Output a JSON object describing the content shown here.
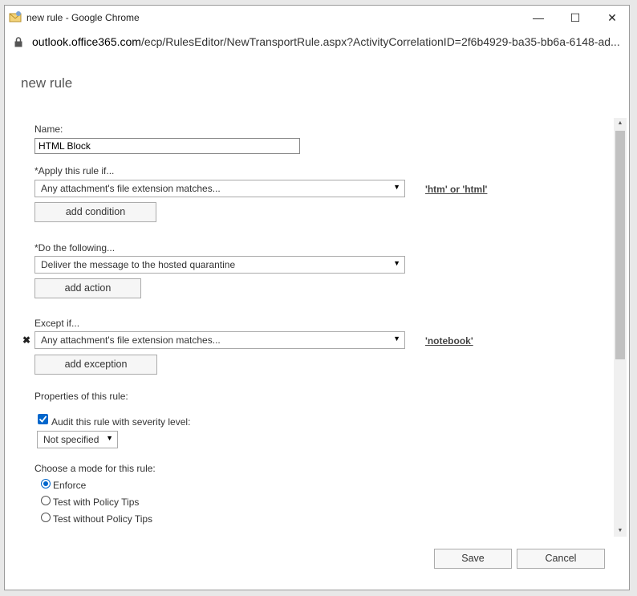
{
  "window": {
    "title": "new rule - Google Chrome",
    "controls": {
      "minimize": "—",
      "maximize": "☐",
      "close": "✕"
    }
  },
  "address_bar": {
    "domain": "outlook.office365.com",
    "path": "/ecp/RulesEditor/NewTransportRule.aspx?ActivityCorrelationID=2f6b4929-ba35-bb6a-6148-ad..."
  },
  "page": {
    "title": "new rule"
  },
  "form": {
    "name_label": "Name:",
    "name_value": "HTML Block",
    "apply_label": "*Apply this rule if...",
    "apply_select": "Any attachment's file extension matches...",
    "apply_link": "'htm' or 'html'",
    "add_condition": "add condition",
    "do_label": "*Do the following...",
    "do_select": "Deliver the message to the hosted quarantine",
    "add_action": "add action",
    "except_label": "Except if...",
    "except_remove": "✖",
    "except_select": "Any attachment's file extension matches...",
    "except_link": "'notebook'",
    "add_exception": "add exception",
    "properties_label": "Properties of this rule:",
    "audit_checked": true,
    "audit_label": "Audit this rule with severity level:",
    "severity_select": "Not specified",
    "mode_label": "Choose a mode for this rule:",
    "modes": [
      {
        "label": "Enforce",
        "selected": true
      },
      {
        "label": "Test with Policy Tips",
        "selected": false
      },
      {
        "label": "Test without Policy Tips",
        "selected": false
      }
    ]
  },
  "footer": {
    "save": "Save",
    "cancel": "Cancel"
  },
  "colors": {
    "accent": "#0066cc",
    "link": "#444444"
  }
}
